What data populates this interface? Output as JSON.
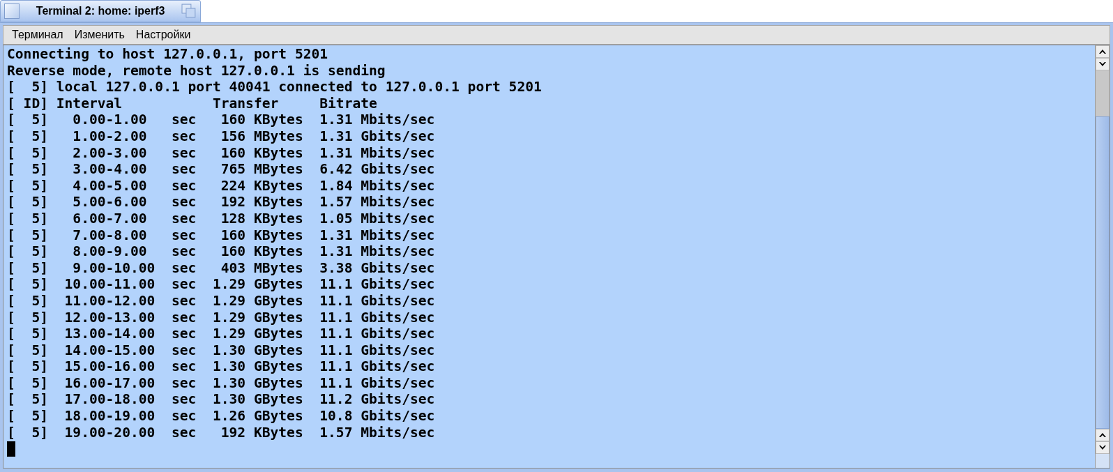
{
  "window": {
    "title": "Terminal 2: home: iperf3"
  },
  "menu": [
    "Терминал",
    "Изменить",
    "Настройки"
  ],
  "terminal": {
    "lines": [
      "Connecting to host 127.0.0.1, port 5201",
      "Reverse mode, remote host 127.0.0.1 is sending",
      "[  5] local 127.0.0.1 port 40041 connected to 127.0.0.1 port 5201",
      "[ ID] Interval           Transfer     Bitrate",
      "[  5]   0.00-1.00   sec   160 KBytes  1.31 Mbits/sec",
      "[  5]   1.00-2.00   sec   156 MBytes  1.31 Gbits/sec",
      "[  5]   2.00-3.00   sec   160 KBytes  1.31 Mbits/sec",
      "[  5]   3.00-4.00   sec   765 MBytes  6.42 Gbits/sec",
      "[  5]   4.00-5.00   sec   224 KBytes  1.84 Mbits/sec",
      "[  5]   5.00-6.00   sec   192 KBytes  1.57 Mbits/sec",
      "[  5]   6.00-7.00   sec   128 KBytes  1.05 Mbits/sec",
      "[  5]   7.00-8.00   sec   160 KBytes  1.31 Mbits/sec",
      "[  5]   8.00-9.00   sec   160 KBytes  1.31 Mbits/sec",
      "[  5]   9.00-10.00  sec   403 MBytes  3.38 Gbits/sec",
      "[  5]  10.00-11.00  sec  1.29 GBytes  11.1 Gbits/sec",
      "[  5]  11.00-12.00  sec  1.29 GBytes  11.1 Gbits/sec",
      "[  5]  12.00-13.00  sec  1.29 GBytes  11.1 Gbits/sec",
      "[  5]  13.00-14.00  sec  1.29 GBytes  11.1 Gbits/sec",
      "[  5]  14.00-15.00  sec  1.30 GBytes  11.1 Gbits/sec",
      "[  5]  15.00-16.00  sec  1.30 GBytes  11.1 Gbits/sec",
      "[  5]  16.00-17.00  sec  1.30 GBytes  11.1 Gbits/sec",
      "[  5]  17.00-18.00  sec  1.30 GBytes  11.2 Gbits/sec",
      "[  5]  18.00-19.00  sec  1.26 GBytes  10.8 Gbits/sec",
      "[  5]  19.00-20.00  sec   192 KBytes  1.57 Mbits/sec"
    ]
  }
}
